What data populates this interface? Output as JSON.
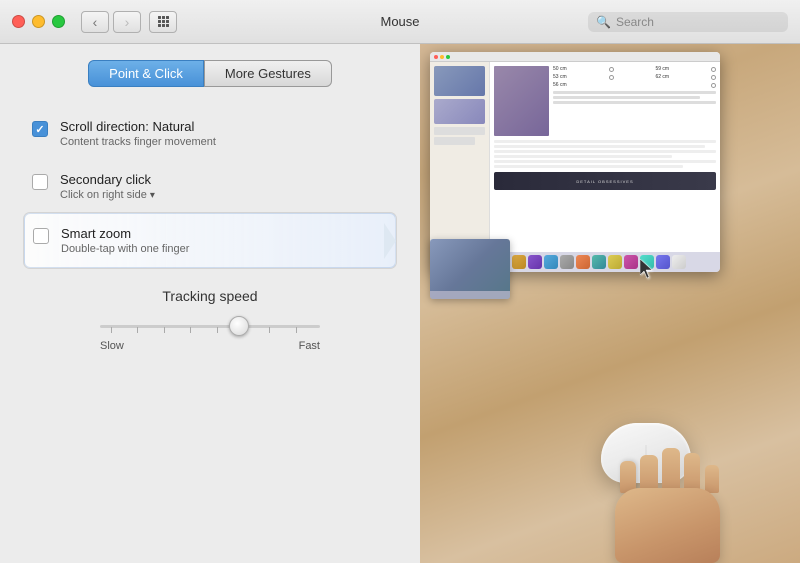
{
  "titleBar": {
    "title": "Mouse",
    "searchPlaceholder": "Search"
  },
  "tabs": [
    {
      "id": "point-click",
      "label": "Point & Click",
      "active": true
    },
    {
      "id": "more-gestures",
      "label": "More Gestures",
      "active": false
    }
  ],
  "options": [
    {
      "id": "scroll-direction",
      "label": "Scroll direction: Natural",
      "sublabel": "Content tracks finger movement",
      "checked": true
    },
    {
      "id": "secondary-click",
      "label": "Secondary click",
      "sublabel": "Click on right side",
      "hasDropdown": true,
      "checked": false
    },
    {
      "id": "smart-zoom",
      "label": "Smart zoom",
      "sublabel": "Double-tap with one finger",
      "checked": false,
      "highlighted": true
    }
  ],
  "trackingSpeed": {
    "label": "Tracking speed",
    "slowLabel": "Slow",
    "fastLabel": "Fast",
    "value": 65
  },
  "icons": {
    "back": "‹",
    "forward": "›",
    "search": "🔍"
  }
}
